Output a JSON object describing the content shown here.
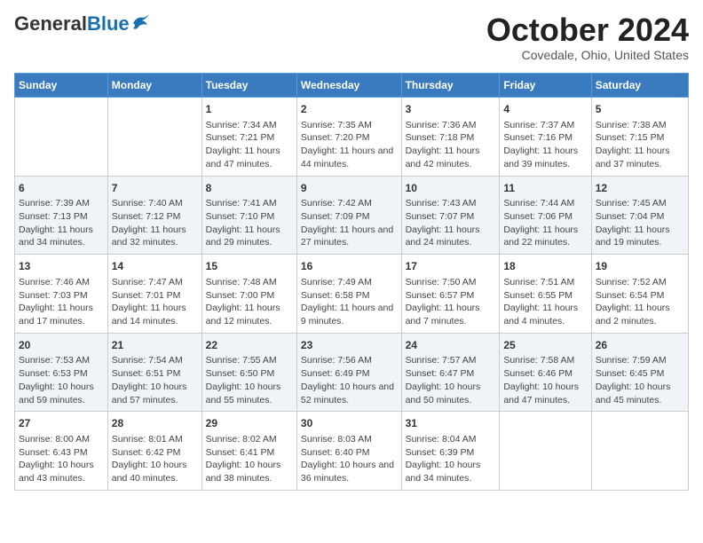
{
  "header": {
    "logo_general": "General",
    "logo_blue": "Blue",
    "month": "October 2024",
    "location": "Covedale, Ohio, United States"
  },
  "weekdays": [
    "Sunday",
    "Monday",
    "Tuesday",
    "Wednesday",
    "Thursday",
    "Friday",
    "Saturday"
  ],
  "weeks": [
    [
      {
        "day": "",
        "sunrise": "",
        "sunset": "",
        "daylight": ""
      },
      {
        "day": "",
        "sunrise": "",
        "sunset": "",
        "daylight": ""
      },
      {
        "day": "1",
        "sunrise": "Sunrise: 7:34 AM",
        "sunset": "Sunset: 7:21 PM",
        "daylight": "Daylight: 11 hours and 47 minutes."
      },
      {
        "day": "2",
        "sunrise": "Sunrise: 7:35 AM",
        "sunset": "Sunset: 7:20 PM",
        "daylight": "Daylight: 11 hours and 44 minutes."
      },
      {
        "day": "3",
        "sunrise": "Sunrise: 7:36 AM",
        "sunset": "Sunset: 7:18 PM",
        "daylight": "Daylight: 11 hours and 42 minutes."
      },
      {
        "day": "4",
        "sunrise": "Sunrise: 7:37 AM",
        "sunset": "Sunset: 7:16 PM",
        "daylight": "Daylight: 11 hours and 39 minutes."
      },
      {
        "day": "5",
        "sunrise": "Sunrise: 7:38 AM",
        "sunset": "Sunset: 7:15 PM",
        "daylight": "Daylight: 11 hours and 37 minutes."
      }
    ],
    [
      {
        "day": "6",
        "sunrise": "Sunrise: 7:39 AM",
        "sunset": "Sunset: 7:13 PM",
        "daylight": "Daylight: 11 hours and 34 minutes."
      },
      {
        "day": "7",
        "sunrise": "Sunrise: 7:40 AM",
        "sunset": "Sunset: 7:12 PM",
        "daylight": "Daylight: 11 hours and 32 minutes."
      },
      {
        "day": "8",
        "sunrise": "Sunrise: 7:41 AM",
        "sunset": "Sunset: 7:10 PM",
        "daylight": "Daylight: 11 hours and 29 minutes."
      },
      {
        "day": "9",
        "sunrise": "Sunrise: 7:42 AM",
        "sunset": "Sunset: 7:09 PM",
        "daylight": "Daylight: 11 hours and 27 minutes."
      },
      {
        "day": "10",
        "sunrise": "Sunrise: 7:43 AM",
        "sunset": "Sunset: 7:07 PM",
        "daylight": "Daylight: 11 hours and 24 minutes."
      },
      {
        "day": "11",
        "sunrise": "Sunrise: 7:44 AM",
        "sunset": "Sunset: 7:06 PM",
        "daylight": "Daylight: 11 hours and 22 minutes."
      },
      {
        "day": "12",
        "sunrise": "Sunrise: 7:45 AM",
        "sunset": "Sunset: 7:04 PM",
        "daylight": "Daylight: 11 hours and 19 minutes."
      }
    ],
    [
      {
        "day": "13",
        "sunrise": "Sunrise: 7:46 AM",
        "sunset": "Sunset: 7:03 PM",
        "daylight": "Daylight: 11 hours and 17 minutes."
      },
      {
        "day": "14",
        "sunrise": "Sunrise: 7:47 AM",
        "sunset": "Sunset: 7:01 PM",
        "daylight": "Daylight: 11 hours and 14 minutes."
      },
      {
        "day": "15",
        "sunrise": "Sunrise: 7:48 AM",
        "sunset": "Sunset: 7:00 PM",
        "daylight": "Daylight: 11 hours and 12 minutes."
      },
      {
        "day": "16",
        "sunrise": "Sunrise: 7:49 AM",
        "sunset": "Sunset: 6:58 PM",
        "daylight": "Daylight: 11 hours and 9 minutes."
      },
      {
        "day": "17",
        "sunrise": "Sunrise: 7:50 AM",
        "sunset": "Sunset: 6:57 PM",
        "daylight": "Daylight: 11 hours and 7 minutes."
      },
      {
        "day": "18",
        "sunrise": "Sunrise: 7:51 AM",
        "sunset": "Sunset: 6:55 PM",
        "daylight": "Daylight: 11 hours and 4 minutes."
      },
      {
        "day": "19",
        "sunrise": "Sunrise: 7:52 AM",
        "sunset": "Sunset: 6:54 PM",
        "daylight": "Daylight: 11 hours and 2 minutes."
      }
    ],
    [
      {
        "day": "20",
        "sunrise": "Sunrise: 7:53 AM",
        "sunset": "Sunset: 6:53 PM",
        "daylight": "Daylight: 10 hours and 59 minutes."
      },
      {
        "day": "21",
        "sunrise": "Sunrise: 7:54 AM",
        "sunset": "Sunset: 6:51 PM",
        "daylight": "Daylight: 10 hours and 57 minutes."
      },
      {
        "day": "22",
        "sunrise": "Sunrise: 7:55 AM",
        "sunset": "Sunset: 6:50 PM",
        "daylight": "Daylight: 10 hours and 55 minutes."
      },
      {
        "day": "23",
        "sunrise": "Sunrise: 7:56 AM",
        "sunset": "Sunset: 6:49 PM",
        "daylight": "Daylight: 10 hours and 52 minutes."
      },
      {
        "day": "24",
        "sunrise": "Sunrise: 7:57 AM",
        "sunset": "Sunset: 6:47 PM",
        "daylight": "Daylight: 10 hours and 50 minutes."
      },
      {
        "day": "25",
        "sunrise": "Sunrise: 7:58 AM",
        "sunset": "Sunset: 6:46 PM",
        "daylight": "Daylight: 10 hours and 47 minutes."
      },
      {
        "day": "26",
        "sunrise": "Sunrise: 7:59 AM",
        "sunset": "Sunset: 6:45 PM",
        "daylight": "Daylight: 10 hours and 45 minutes."
      }
    ],
    [
      {
        "day": "27",
        "sunrise": "Sunrise: 8:00 AM",
        "sunset": "Sunset: 6:43 PM",
        "daylight": "Daylight: 10 hours and 43 minutes."
      },
      {
        "day": "28",
        "sunrise": "Sunrise: 8:01 AM",
        "sunset": "Sunset: 6:42 PM",
        "daylight": "Daylight: 10 hours and 40 minutes."
      },
      {
        "day": "29",
        "sunrise": "Sunrise: 8:02 AM",
        "sunset": "Sunset: 6:41 PM",
        "daylight": "Daylight: 10 hours and 38 minutes."
      },
      {
        "day": "30",
        "sunrise": "Sunrise: 8:03 AM",
        "sunset": "Sunset: 6:40 PM",
        "daylight": "Daylight: 10 hours and 36 minutes."
      },
      {
        "day": "31",
        "sunrise": "Sunrise: 8:04 AM",
        "sunset": "Sunset: 6:39 PM",
        "daylight": "Daylight: 10 hours and 34 minutes."
      },
      {
        "day": "",
        "sunrise": "",
        "sunset": "",
        "daylight": ""
      },
      {
        "day": "",
        "sunrise": "",
        "sunset": "",
        "daylight": ""
      }
    ]
  ]
}
